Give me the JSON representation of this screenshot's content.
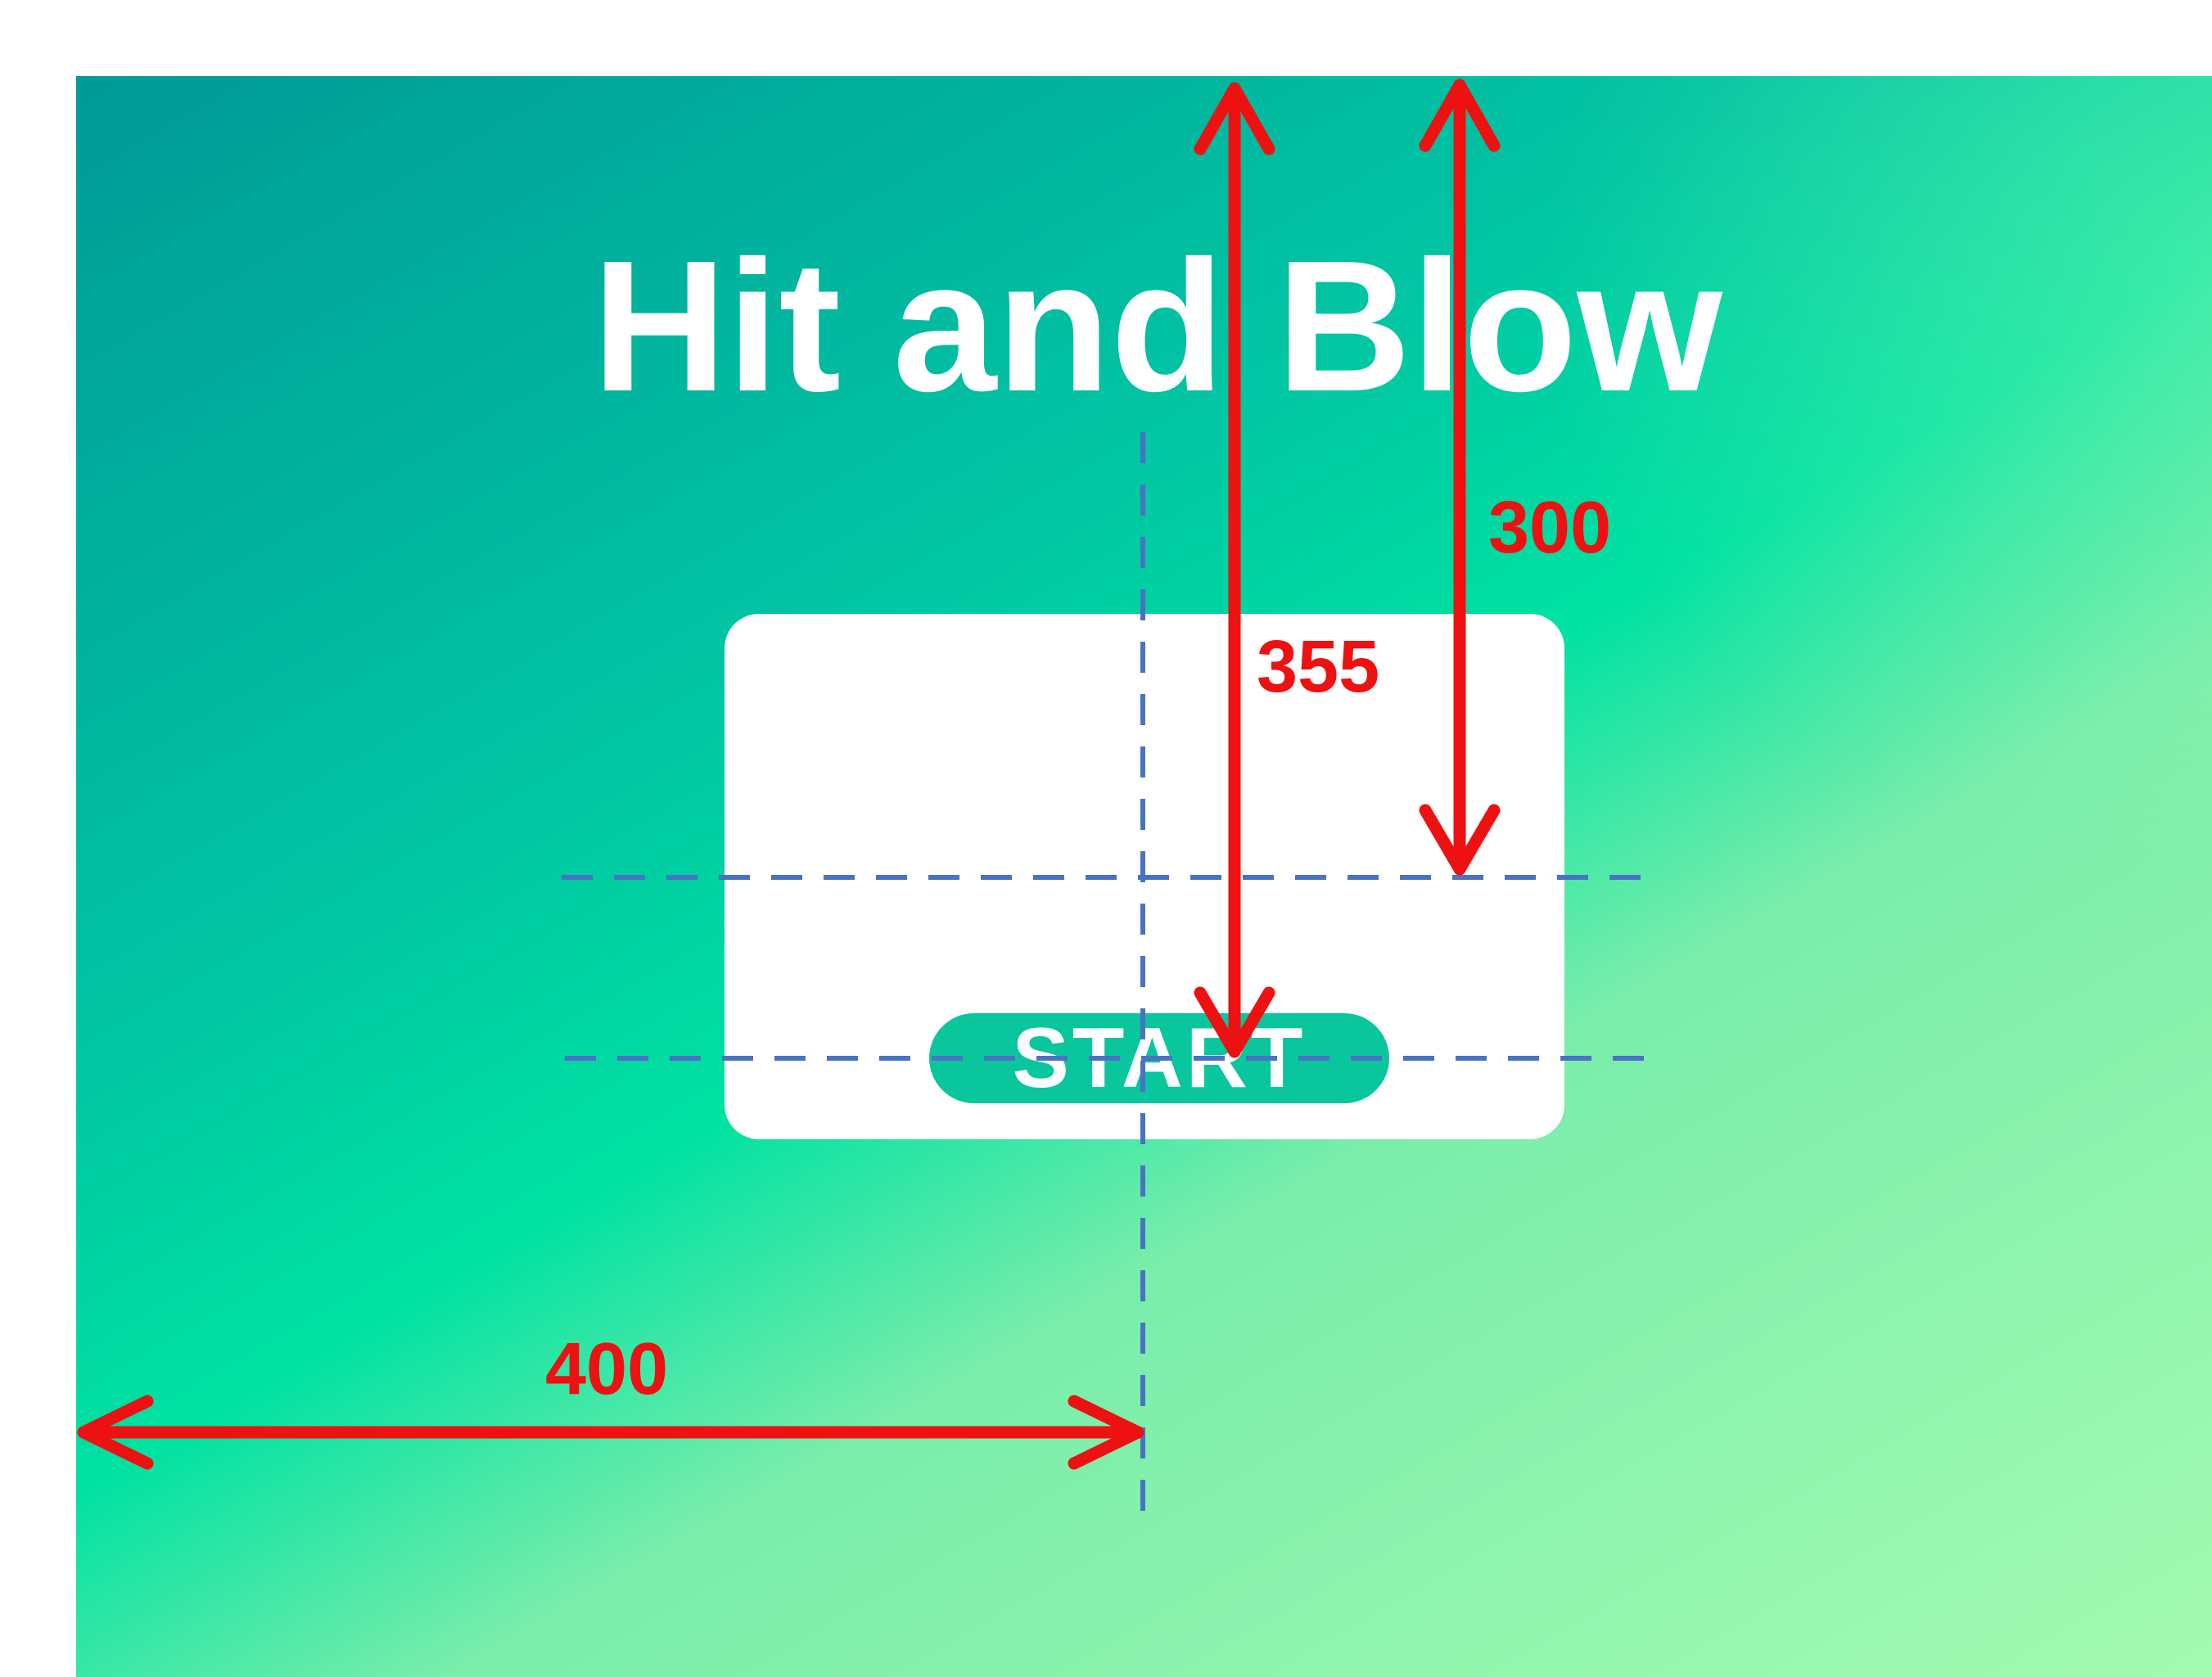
{
  "title": "Hit and Blow",
  "start_button_label": "START",
  "dimension_labels": {
    "distance_to_button": "355",
    "distance_to_panel_center": "300",
    "distance_to_center_x": "400"
  },
  "colors": {
    "background_gradient": [
      "#009a96",
      "#01c4a3",
      "#00e2a2",
      "#7aedab",
      "#a4fbb1"
    ],
    "panel": "#ffffff",
    "start_button": "#09c69d",
    "dimension_arrow": "#ee1111",
    "guide_line": "#4a72c4"
  }
}
